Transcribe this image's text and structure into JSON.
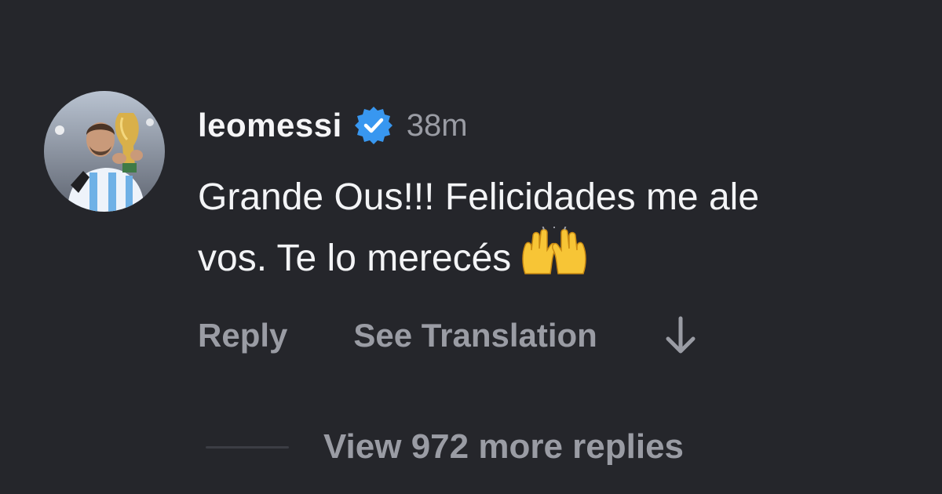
{
  "comment": {
    "username": "leomessi",
    "verified": true,
    "timestamp": "38m",
    "text_line_1": "Grande Ous!!! Felicidades me ale",
    "text_line_2": "vos. Te lo merecés",
    "emoji": "raising-hands"
  },
  "actions": {
    "reply_label": "Reply",
    "translate_label": "See Translation",
    "arrow_icon": "arrow-down-icon"
  },
  "replies": {
    "label": "View 972 more replies"
  },
  "colors": {
    "background": "#25262b",
    "text_primary": "#f3f4f6",
    "text_secondary": "#9a9ca4",
    "verified_badge": "#3897f0"
  }
}
